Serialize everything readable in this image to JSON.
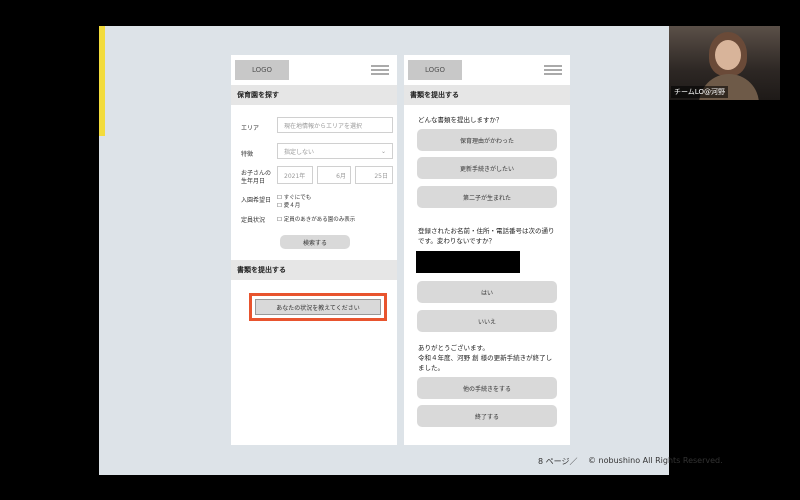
{
  "video": {
    "participant_name": "チームLO@河野"
  },
  "footer": {
    "page": "8 ページ／",
    "copyright": "© nobushino All Rights Reserved."
  },
  "left_phone": {
    "logo": "LOGO",
    "section1_title": "保育園を探す",
    "area_label": "エリア",
    "area_placeholder": "現在地情報からエリアを選択",
    "feature_label": "特徴",
    "feature_value": "指定しない",
    "birthday_label1": "お子さんの",
    "birthday_label2": "生年月日",
    "birth_year": "2021年",
    "birth_month": "6月",
    "birth_day": "25日",
    "entry_label": "入園希望日",
    "entry_opt1": "すぐにでも",
    "entry_opt2": "愛４月",
    "capacity_label": "定員状況",
    "capacity_opt": "定員のあきがある園のみ表示",
    "search_button": "検索する",
    "section2_title": "書類を提出する",
    "status_button": "あなたの状況を教えてください"
  },
  "right_phone": {
    "logo": "LOGO",
    "section_title": "書類を提出する",
    "question1": "どんな書類を提出しますか？",
    "opt1": "保育理由がかわった",
    "opt2": "更新手続きがしたい",
    "opt3": "第二子が生まれた",
    "question2_line1": "登録されたお名前・住所・電話番号は次の通り",
    "question2_line2": "です。変わりないですか？",
    "yes_button": "はい",
    "no_button": "いいえ",
    "thanks_line1": "ありがとうございます。",
    "thanks_line2": "令和４年度、河野 創 様の更新手続きが終了し",
    "thanks_line3": "ました。",
    "other_button": "他の手続きをする",
    "end_button": "終了する"
  },
  "colors": {
    "slide_bg": "#dde3e8",
    "accent": "#f3dc3c",
    "highlight": "#e8542e"
  }
}
